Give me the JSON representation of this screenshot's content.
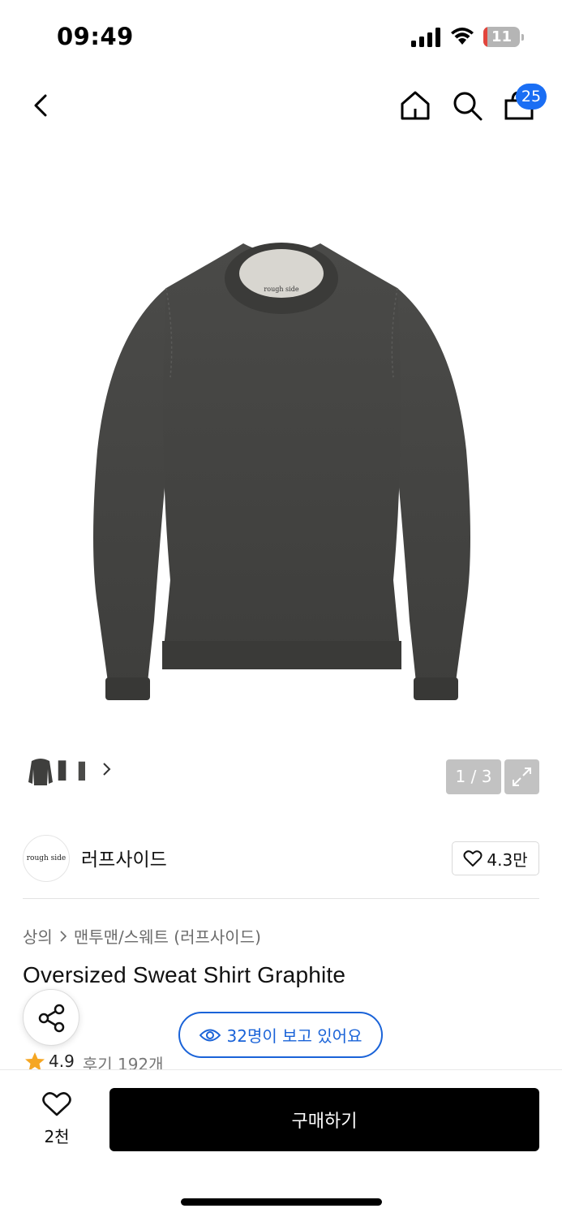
{
  "status_bar": {
    "time": "09:49",
    "battery": "11",
    "battery_level": 0.11,
    "battery_color": "#e2453c"
  },
  "nav": {
    "cart_count": "25"
  },
  "gallery": {
    "page_indicator": "1 / 3",
    "current": 1,
    "total": 3,
    "product_tag": "rough side"
  },
  "brand": {
    "logo_text": "rough side",
    "name": "러프사이드",
    "likes": "4.3만"
  },
  "breadcrumb": {
    "category": "상의",
    "subcategory": "맨투맨/스웨트 (러프사이드)"
  },
  "product": {
    "title": "Oversized Sweat Shirt Graphite",
    "viewers": "32명이 보고 있어요",
    "rating": "4.9",
    "reviews": "후기 192개"
  },
  "bottom_bar": {
    "wish_count": "2천",
    "buy_label": "구매하기"
  },
  "colors": {
    "accent": "#1a63d8",
    "badge": "#1a6ef4",
    "star": "#f5a623",
    "buy_button": "#000000"
  }
}
